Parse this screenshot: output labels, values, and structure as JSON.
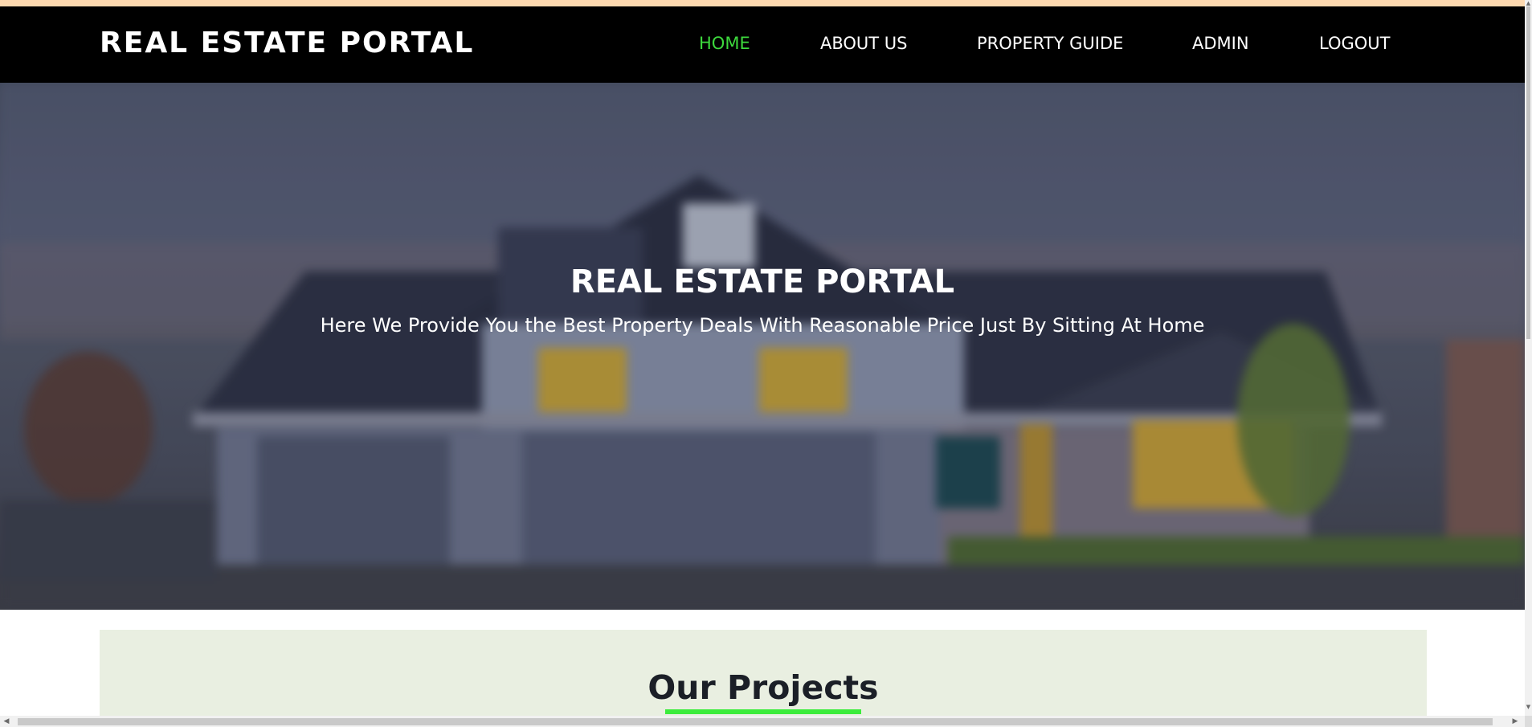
{
  "header": {
    "brand": "REAL ESTATE PORTAL",
    "nav": [
      {
        "label": "HOME",
        "active": true
      },
      {
        "label": "ABOUT US",
        "active": false
      },
      {
        "label": "PROPERTY GUIDE",
        "active": false
      },
      {
        "label": "ADMIN",
        "active": false
      },
      {
        "label": "LOGOUT",
        "active": false
      }
    ]
  },
  "hero": {
    "title": "REAL ESTATE PORTAL",
    "subtitle": "Here We Provide You the Best Property Deals With Reasonable Price Just By Sitting At Home",
    "image": "blurred-house-photo"
  },
  "projects": {
    "title": "Our Projects"
  },
  "scrollbars": {
    "up_icon": "scroll-up-arrow-icon",
    "down_icon": "scroll-down-arrow-icon",
    "left_icon": "scroll-left-arrow-icon",
    "right_icon": "scroll-right-arrow-icon"
  },
  "colors": {
    "navbar": "#000000",
    "active_nav": "#3dd93d",
    "top_strip": "#fdd9b0",
    "projects_bg": "#e9efe1",
    "underline": "#3cec3c"
  }
}
